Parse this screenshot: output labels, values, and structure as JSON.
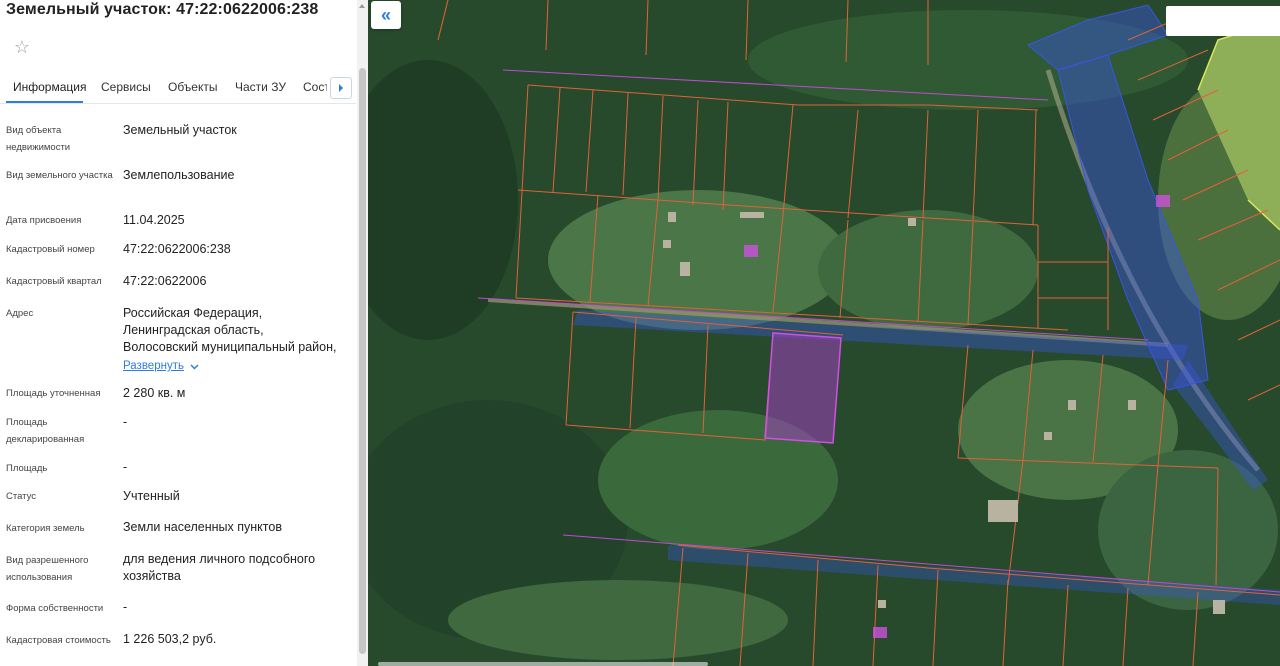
{
  "header": {
    "title": "Земельный участок: 47:22:0622006:238",
    "favorite_icon": "star-icon"
  },
  "tabs": [
    {
      "label": "Информация",
      "active": true
    },
    {
      "label": "Сервисы"
    },
    {
      "label": "Объекты"
    },
    {
      "label": "Части ЗУ"
    },
    {
      "label": "Соста"
    }
  ],
  "tabs_next_icon": "chevron-right-icon",
  "fields": {
    "object_type": {
      "label": "Вид объекта недвижимости",
      "value": "Земельный участок"
    },
    "plot_type": {
      "label": "Вид земельного участка",
      "value": "Землепользование"
    },
    "assigned_date": {
      "label": "Дата присвоения",
      "value": "11.04.2025"
    },
    "cadastral_number": {
      "label": "Кадастровый номер",
      "value": "47:22:0622006:238"
    },
    "cadastral_block": {
      "label": "Кадастровый квартал",
      "value": "47:22:0622006"
    },
    "address": {
      "label": "Адрес",
      "lines": [
        "Российская Федерация,",
        "Ленинградская область,",
        "Волосовский муниципальный район,"
      ],
      "expand": "Развернуть"
    },
    "area_specified": {
      "label": "Площадь уточненная",
      "value": "2 280 кв. м"
    },
    "area_declared": {
      "label": "Площадь декларированная",
      "value": "-"
    },
    "area": {
      "label": "Площадь",
      "value": "-"
    },
    "status": {
      "label": "Статус",
      "value": "Учтенный"
    },
    "land_category": {
      "label": "Категория земель",
      "value": "Земли населенных пунктов"
    },
    "permitted_use": {
      "label": "Вид разрешенного использования",
      "value": "для ведения личного подсобного хозяйства"
    },
    "ownership_form": {
      "label": "Форма собственности",
      "value": "-"
    },
    "cadastral_value": {
      "label": "Кадастровая стоимость",
      "value": "1 226 503,2 руб."
    }
  },
  "map": {
    "collapse_icon": "double-chevron-left-icon",
    "collapse_glyph": "«",
    "colors": {
      "parcel_border": "#e0623a",
      "selected_parcel": "#a040c0",
      "road_zone": "#3a55e0",
      "adjacent_zone": "#d8e85a"
    }
  }
}
